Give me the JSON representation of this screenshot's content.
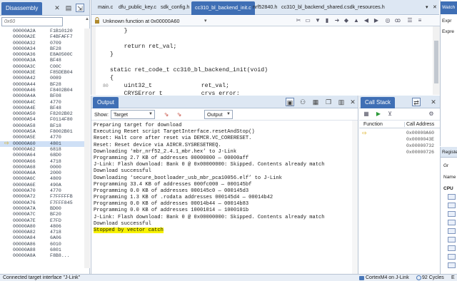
{
  "disassembly": {
    "tab_label": "Disassembly",
    "search_placeholder": "0x60",
    "rows": [
      {
        "addr": "00000A2A",
        "code": "F1B10120"
      },
      {
        "addr": "00000A2E",
        "code": "F4BFAFF7"
      },
      {
        "addr": "00000A32",
        "code": "0709"
      },
      {
        "addr": "00000A34",
        "code": "BF28"
      },
      {
        "addr": "00000A36",
        "code": "E8A0500C"
      },
      {
        "addr": "00000A3A",
        "code": "BF48"
      },
      {
        "addr": "00000A3C",
        "code": "C00C"
      },
      {
        "addr": "00000A3E",
        "code": "F85DEB04"
      },
      {
        "addr": "00000A42",
        "code": "0089"
      },
      {
        "addr": "00000A44",
        "code": "BF28"
      },
      {
        "addr": "00000A46",
        "code": "F8402B04"
      },
      {
        "addr": "00000A4A",
        "code": "BF08"
      },
      {
        "addr": "00000A4C",
        "code": "4770"
      },
      {
        "addr": "00000A4E",
        "code": "BF48"
      },
      {
        "addr": "00000A50",
        "code": "F8202B02"
      },
      {
        "addr": "00000A54",
        "code": "F0114F80"
      },
      {
        "addr": "00000A58",
        "code": "BF18"
      },
      {
        "addr": "00000A5A",
        "code": "F8002B01"
      },
      {
        "addr": "00000A5E",
        "code": "4770"
      },
      {
        "addr": "00000A60",
        "code": "4801"
      },
      {
        "addr": "00000A62",
        "code": "6818"
      },
      {
        "addr": "00000A64",
        "code": "68D0"
      },
      {
        "addr": "00000A66",
        "code": "4718"
      },
      {
        "addr": "00000A68",
        "code": "0000"
      },
      {
        "addr": "00000A6A",
        "code": "2000"
      },
      {
        "addr": "00000A6C",
        "code": "4809"
      },
      {
        "addr": "00000A6E",
        "code": "490A"
      },
      {
        "addr": "00000A70",
        "code": "4770"
      },
      {
        "addr": "00000A72",
        "code": "F7FFFFFB"
      },
      {
        "addr": "00000A76",
        "code": "F7FFF845"
      },
      {
        "addr": "00000A7A",
        "code": "BD00"
      },
      {
        "addr": "00000A7C",
        "code": "BF20"
      },
      {
        "addr": "00000A7E",
        "code": "E7FD"
      },
      {
        "addr": "00000A80",
        "code": "4806"
      },
      {
        "addr": "00000A82",
        "code": "4718"
      },
      {
        "addr": "00000A84",
        "code": "6A06"
      },
      {
        "addr": "00000A86",
        "code": "6010"
      },
      {
        "addr": "00000A88",
        "code": "6801"
      },
      {
        "addr": "00000A8A",
        "code": "F8B8..."
      }
    ],
    "current_row_index": 19
  },
  "editor": {
    "tabs": [
      "main.c",
      "dfu_public_key.c",
      "sdk_config.h",
      "cc310_bl_backend_init.c",
      "nrf52840.h",
      "cc310_bl_backend_shared.c",
      "sdk_resources.h"
    ],
    "active_tab_index": 3,
    "function_label": "Unknown function at 0x00000A60",
    "code_lines": [
      {
        "text": "    }",
        "lineno": ""
      },
      {
        "text": "",
        "lineno": ""
      },
      {
        "text": "    return ret_val;",
        "lineno": ""
      },
      {
        "text": "}",
        "lineno": ""
      },
      {
        "text": "",
        "lineno": ""
      },
      {
        "text": "static ret_code_t cc310_bl_backend_init(void)",
        "lineno": ""
      },
      {
        "text": "{",
        "lineno": ""
      },
      {
        "text": "    uint32_t              ret_val;",
        "lineno": "80"
      },
      {
        "text": "    CRYSError_t           crys_error;",
        "lineno": ""
      }
    ]
  },
  "watch": {
    "tab_label": "Watch",
    "rows": [
      "Expr",
      "Expre"
    ]
  },
  "registers": {
    "tab_label": "Registers",
    "rows": [
      "Gr",
      "Name",
      "CPU"
    ]
  },
  "output": {
    "tab_label": "Output",
    "show_label": "Show:",
    "target_select": "Target",
    "output_select": "Output",
    "lines": [
      "Preparing target for download",
      "Executing Reset script TargetInterface.resetAndStop()",
      "Reset: Halt core after reset via DEMCR.VC_CORERESET.",
      "Reset: Reset device via AIRCR.SYSRESETREQ.",
      "Downloading ‘mbr_nrf52_2.4.1_mbr.hex’ to J-Link",
      "Programming 2.7 KB of addresses 00000000 — 00000aff",
      "J-Link: Flash download: Bank 0 @ 0x00000000: Skipped. Contents already match",
      "Download successful",
      "Downloading ‘secure_bootloader_usb_mbr_pca10056.elf’ to J-Link",
      "Programming 33.4 KB of addresses 000fc000 — 000145bf",
      "Programming 0.0 KB of addresses 000145c0 — 000145d3",
      "Programming 1.3 KB of .rodata addresses 000145d4 — 00014b42",
      "Programming 0.0 KB of addresses 00014b44 — 00014b83",
      "Programming 0.0 KB of addresses 10001014 — 1000101b",
      "J-Link: Flash download: Bank 0 @ 0x00000000: Skipped. Contents already match",
      "Download successful",
      "Stopped by vector catch"
    ],
    "highlight_index": 16,
    "highlight_color": "#f7f200"
  },
  "callstack": {
    "tab_label": "Call Stack",
    "col_function": "Function",
    "col_address": "Call Address",
    "rows": [
      "0x00000A60",
      "0x0000043E",
      "0x00000732",
      "0x00000726"
    ],
    "current_index": 0
  },
  "status": {
    "connection": "Connected target interface \"J-Link\"",
    "device": "CortexM4 on J-Link",
    "cycles": "92 Cycles",
    "extra": "E"
  },
  "colors": {
    "accent": "#3f6fb5",
    "panel_header": "#dde7f3",
    "current_line": "#cfe0f6",
    "arrow": "#d7a400"
  }
}
